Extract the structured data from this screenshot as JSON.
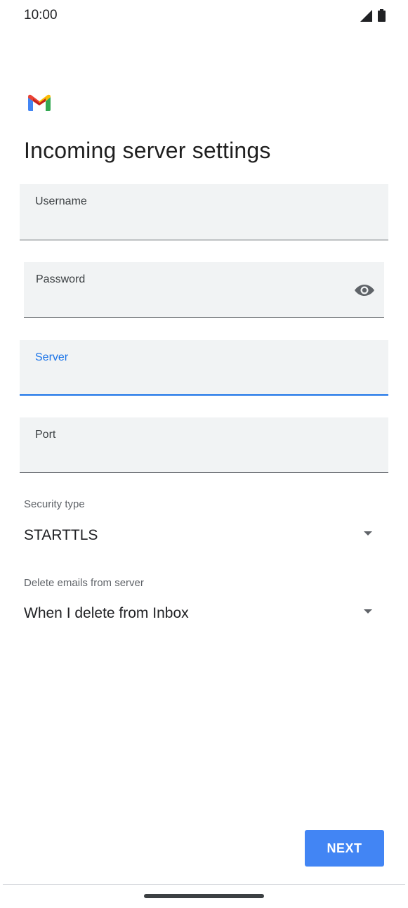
{
  "status_bar": {
    "time": "10:00"
  },
  "header": {
    "title": "Incoming server settings"
  },
  "fields": {
    "username": {
      "label": "Username",
      "value": ""
    },
    "password": {
      "label": "Password",
      "value": ""
    },
    "server": {
      "label": "Server",
      "value": ""
    },
    "port": {
      "label": "Port",
      "value": ""
    }
  },
  "security_type": {
    "label": "Security type",
    "value": "STARTTLS"
  },
  "delete_emails": {
    "label": "Delete emails from server",
    "value": "When I delete from Inbox"
  },
  "actions": {
    "next_label": "NEXT"
  },
  "colors": {
    "accent": "#1a73e8",
    "button": "#4285f4",
    "field_bg": "#f1f3f4"
  },
  "icons": {
    "logo": "gmail-logo-icon",
    "password_toggle": "eye-icon",
    "dropdown": "caret-down-icon",
    "signal": "signal-icon",
    "battery": "battery-icon"
  }
}
